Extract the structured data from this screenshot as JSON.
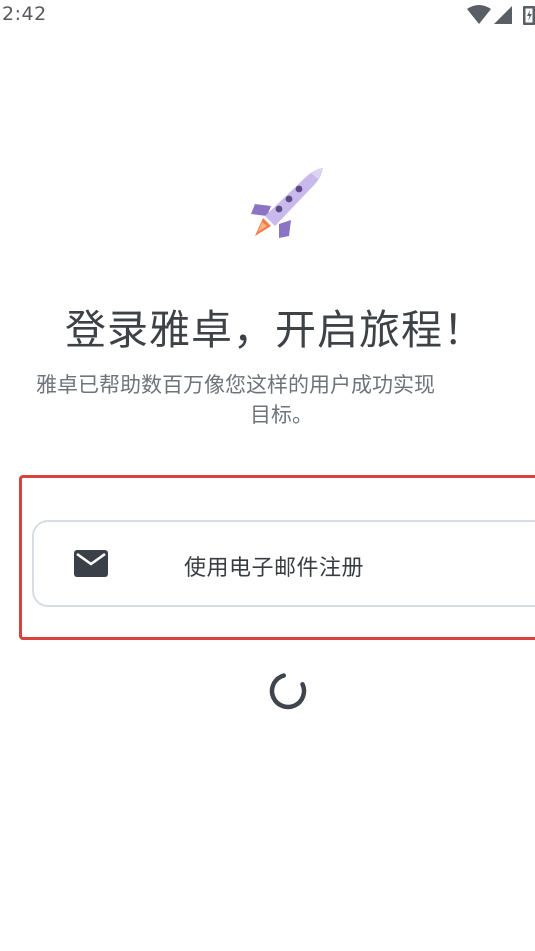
{
  "status_bar": {
    "time": "2:42",
    "icons": [
      "wifi-icon",
      "signal-icon",
      "battery-icon"
    ]
  },
  "hero": {
    "icon": "rocket-icon",
    "title": "登录雅卓，开启旅程！",
    "subtitle_line1": "雅卓已帮助数百万像您这样的用户成功实现",
    "subtitle_line2": "目标。"
  },
  "signup": {
    "email_button_label": "使用电子邮件注册",
    "email_icon": "mail-icon"
  },
  "loading": {
    "icon": "spinner-icon"
  },
  "colors": {
    "highlight_border": "#d9423e",
    "button_border": "#d9dde2",
    "title_text": "#3e4247",
    "subtitle_text": "#6f747a",
    "rocket_body": "#c8b8ec",
    "rocket_accent": "#8c74c4",
    "rocket_flame": "#f07a4a"
  }
}
